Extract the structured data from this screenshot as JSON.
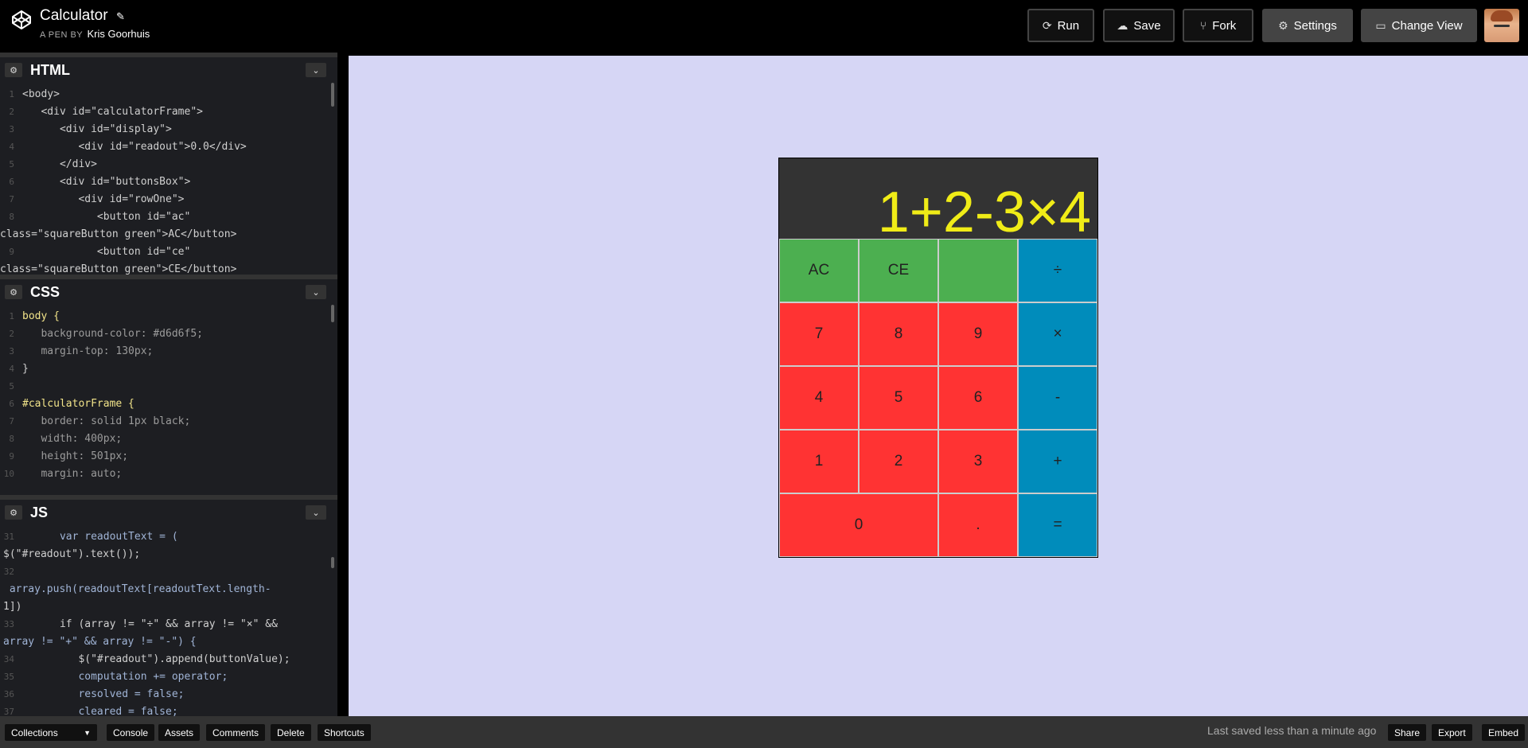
{
  "header": {
    "title": "Calculator",
    "by_prefix": "A PEN BY",
    "author": "Kris Goorhuis",
    "buttons": {
      "run": "Run",
      "save": "Save",
      "fork": "Fork",
      "settings": "Settings",
      "change_view": "Change View"
    }
  },
  "editors": {
    "html": {
      "name": "HTML",
      "lines": [
        {
          "n": "1",
          "t": "<body>"
        },
        {
          "n": "2",
          "t": "   <div id=\"calculatorFrame\">"
        },
        {
          "n": "3",
          "t": "      <div id=\"display\">"
        },
        {
          "n": "4",
          "t": "         <div id=\"readout\">0.0</div>"
        },
        {
          "n": "5",
          "t": "      </div>"
        },
        {
          "n": "6",
          "t": "      <div id=\"buttonsBox\">"
        },
        {
          "n": "7",
          "t": "         <div id=\"rowOne\">"
        },
        {
          "n": "8",
          "t": "            <button id=\"ac\""
        },
        {
          "n": "",
          "t": "class=\"squareButton green\">AC</button>"
        },
        {
          "n": "9",
          "t": "            <button id=\"ce\""
        },
        {
          "n": "",
          "t": "class=\"squareButton green\">CE</button>"
        }
      ]
    },
    "css": {
      "name": "CSS",
      "lines": [
        {
          "n": "1",
          "t": "body {"
        },
        {
          "n": "2",
          "t": "   background-color: #d6d6f5;"
        },
        {
          "n": "3",
          "t": "   margin-top: 130px;"
        },
        {
          "n": "4",
          "t": "}"
        },
        {
          "n": "5",
          "t": ""
        },
        {
          "n": "6",
          "t": "#calculatorFrame {"
        },
        {
          "n": "7",
          "t": "   border: solid 1px black;"
        },
        {
          "n": "8",
          "t": "   width: 400px;"
        },
        {
          "n": "9",
          "t": "   height: 501px;"
        },
        {
          "n": "10",
          "t": "   margin: auto;"
        }
      ]
    },
    "js": {
      "name": "JS",
      "lines": [
        {
          "n": "31",
          "t": "      var readoutText = ("
        },
        {
          "n": "",
          "t": "$(\"#readout\").text());"
        },
        {
          "n": "32",
          "t": ""
        },
        {
          "n": "",
          "t": " array.push(readoutText[readoutText.length-"
        },
        {
          "n": "",
          "t": "1])"
        },
        {
          "n": "33",
          "t": "      if (array != \"÷\" && array != \"×\" &&"
        },
        {
          "n": "",
          "t": "array != \"+\" && array != \"-\") {"
        },
        {
          "n": "34",
          "t": "         $(\"#readout\").append(buttonValue);"
        },
        {
          "n": "35",
          "t": "         computation += operator;"
        },
        {
          "n": "36",
          "t": "         resolved = false;"
        },
        {
          "n": "37",
          "t": "         cleared = false;"
        }
      ]
    }
  },
  "calculator": {
    "readout": "1+2-3×4",
    "keys": [
      "AC",
      "CE",
      "",
      "÷",
      "7",
      "8",
      "9",
      "×",
      "4",
      "5",
      "6",
      "-",
      "1",
      "2",
      "3",
      "+",
      "0",
      ".",
      "="
    ],
    "colors": {
      "green": "#4caf50",
      "red": "#ff3333",
      "blue": "#008cbb",
      "display": "#333333",
      "readout": "#f0ec17",
      "background": "#d6d6f5"
    }
  },
  "footer": {
    "collections": "Collections",
    "console": "Console",
    "assets": "Assets",
    "comments": "Comments",
    "delete": "Delete",
    "shortcuts": "Shortcuts",
    "saved_status": "Last saved less than a minute ago",
    "share": "Share",
    "export": "Export",
    "embed": "Embed"
  }
}
